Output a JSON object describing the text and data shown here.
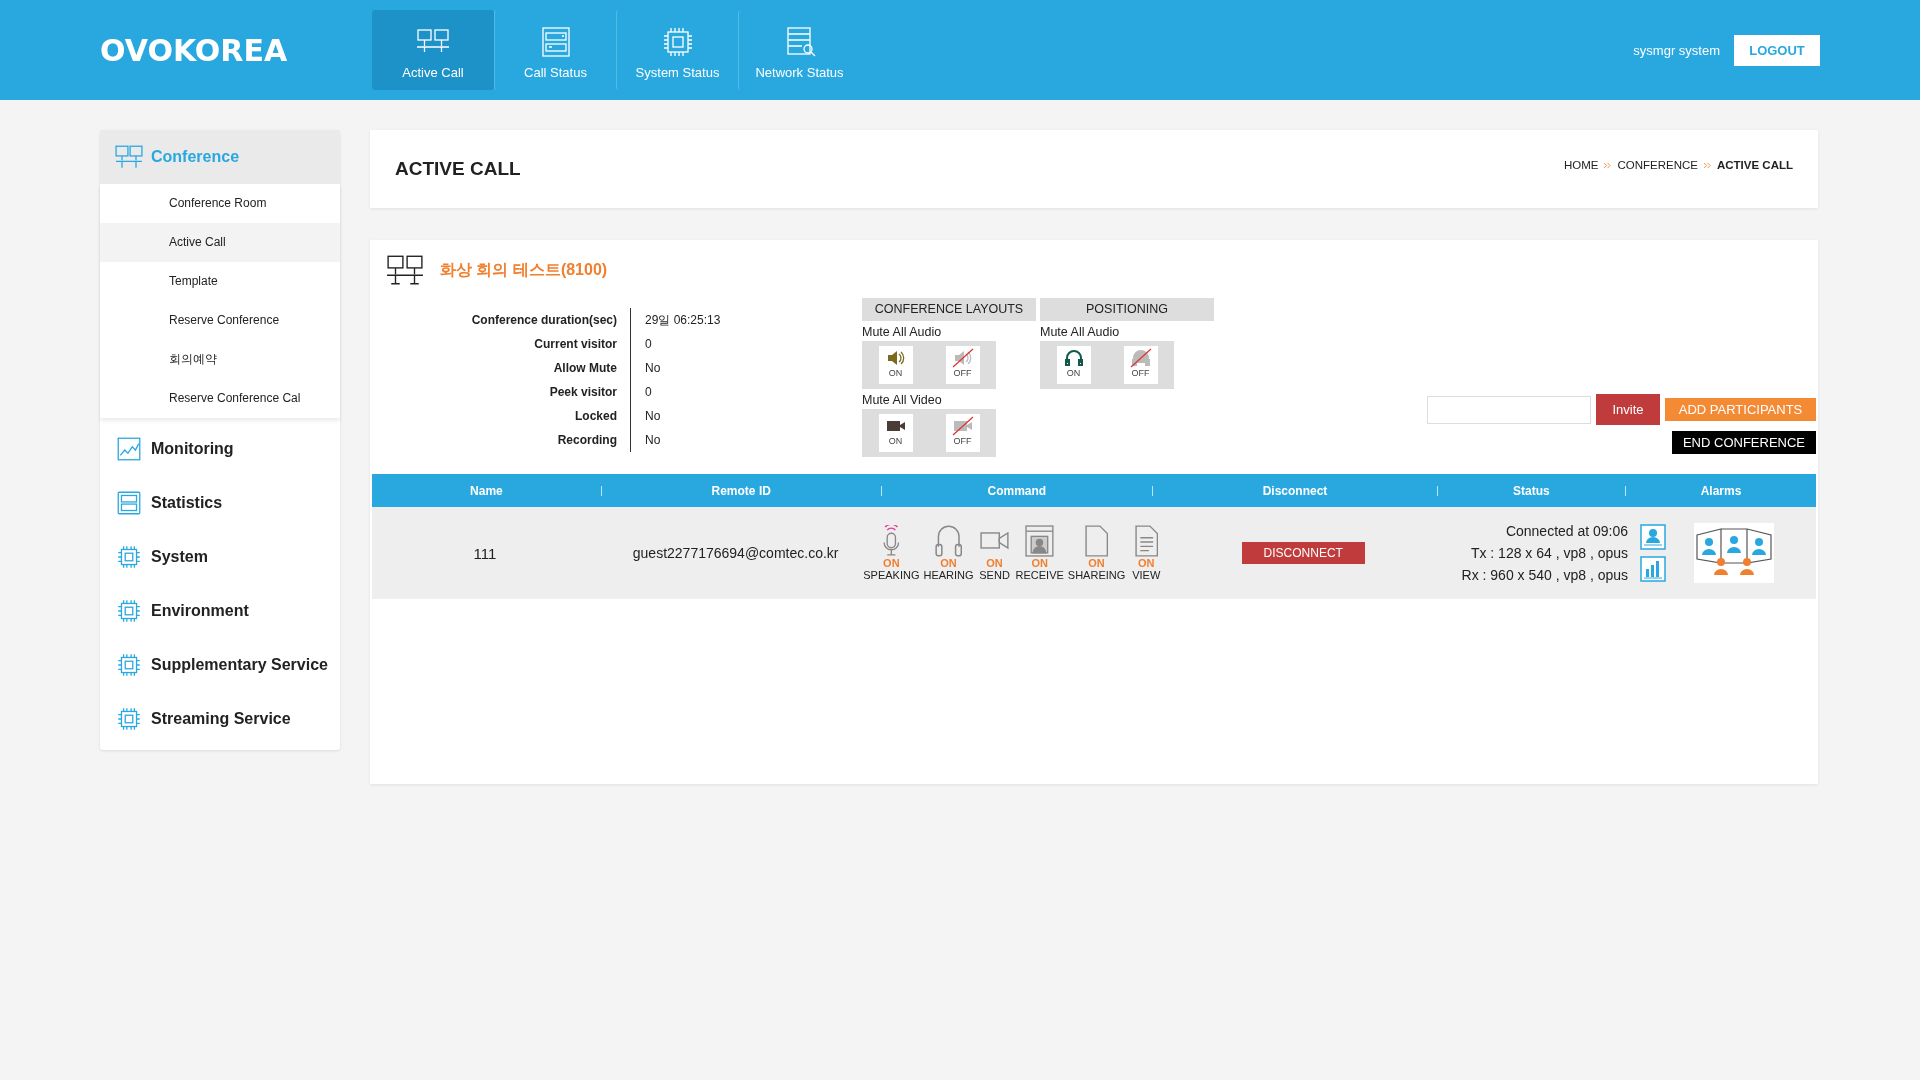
{
  "header": {
    "logo": "OVOKOREA",
    "nav": [
      {
        "label": "Active Call",
        "kind": "monitors",
        "selected": true
      },
      {
        "label": "Call Status",
        "kind": "server",
        "selected": false
      },
      {
        "label": "System Status",
        "kind": "chip",
        "selected": false
      },
      {
        "label": "Network Status",
        "kind": "search",
        "selected": false
      }
    ],
    "user": "sysmgr system",
    "logout": "LOGOUT"
  },
  "sidebar": {
    "sections": [
      {
        "label": "Conference",
        "kind": "monitors",
        "expanded": true,
        "children": [
          {
            "label": "Conference Room",
            "selected": false
          },
          {
            "label": "Active Call",
            "selected": true
          },
          {
            "label": "Template",
            "selected": false
          },
          {
            "label": "Reserve Conference",
            "selected": false
          },
          {
            "label": "회의예약",
            "selected": false
          },
          {
            "label": "Reserve Conference Cal",
            "selected": false
          }
        ]
      },
      {
        "label": "Monitoring",
        "kind": "chart",
        "expanded": false
      },
      {
        "label": "Statistics",
        "kind": "server",
        "expanded": false
      },
      {
        "label": "System",
        "kind": "chip",
        "expanded": false
      },
      {
        "label": "Environment",
        "kind": "chip",
        "expanded": false
      },
      {
        "label": "Supplementary Service",
        "kind": "chip",
        "expanded": false
      },
      {
        "label": "Streaming Service",
        "kind": "chip",
        "expanded": false
      }
    ]
  },
  "page": {
    "title": "ACTIVE CALL",
    "breadcrumb": [
      "HOME",
      "CONFERENCE",
      "ACTIVE CALL"
    ]
  },
  "conference": {
    "title": "화상 회의 테스트(8100)",
    "info": [
      {
        "label": "Conference duration(sec)",
        "value": "29일 06:25:13"
      },
      {
        "label": "Current visitor",
        "value": "0"
      },
      {
        "label": "Allow Mute",
        "value": "No"
      },
      {
        "label": "Peek visitor",
        "value": "0"
      },
      {
        "label": "Locked",
        "value": "No"
      },
      {
        "label": "Recording",
        "value": "No"
      }
    ],
    "panels": [
      {
        "tab": "CONFERENCE LAYOUTS",
        "groups": [
          {
            "label": "Mute All Audio",
            "kind": "speaker",
            "buttons": [
              {
                "kind": "on",
                "label": "ON"
              },
              {
                "kind": "off",
                "label": "OFF"
              }
            ]
          },
          {
            "label": "Mute All Video",
            "kind": "camera",
            "buttons": [
              {
                "kind": "on",
                "label": "ON"
              },
              {
                "kind": "off",
                "label": "OFF"
              }
            ]
          }
        ]
      },
      {
        "tab": "POSITIONING",
        "groups": [
          {
            "label": "Mute All Audio",
            "kind": "headset",
            "buttons": [
              {
                "kind": "on",
                "label": "ON"
              },
              {
                "kind": "off",
                "label": "OFF"
              }
            ]
          }
        ]
      }
    ],
    "invite": "Invite",
    "add": "ADD PARTICIPANTS",
    "end": "END CONFERENCE"
  },
  "table": {
    "columns": [
      "Name",
      "Remote ID",
      "Command",
      "Disconnect",
      "Status",
      "Alarms"
    ],
    "rows": [
      {
        "name": "111",
        "remote_id": "guest2277176694@comtec.co.kr",
        "commands": [
          {
            "kind": "mic",
            "state": "ON",
            "label": "SPEAKING"
          },
          {
            "kind": "headset",
            "state": "ON",
            "label": "HEARING"
          },
          {
            "kind": "camera",
            "state": "ON",
            "label": "SEND"
          },
          {
            "kind": "window",
            "state": "ON",
            "label": "RECEIVE"
          },
          {
            "kind": "file",
            "state": "ON",
            "label": "SHAREING"
          },
          {
            "kind": "doc",
            "state": "ON",
            "label": "VIEW"
          }
        ],
        "disconnect": "DISCONNECT",
        "status": [
          "Connected at 09:06",
          "Tx : 128 x 64 , vp8 , opus",
          "Rx : 960 x 540 , vp8 , opus"
        ]
      }
    ]
  }
}
